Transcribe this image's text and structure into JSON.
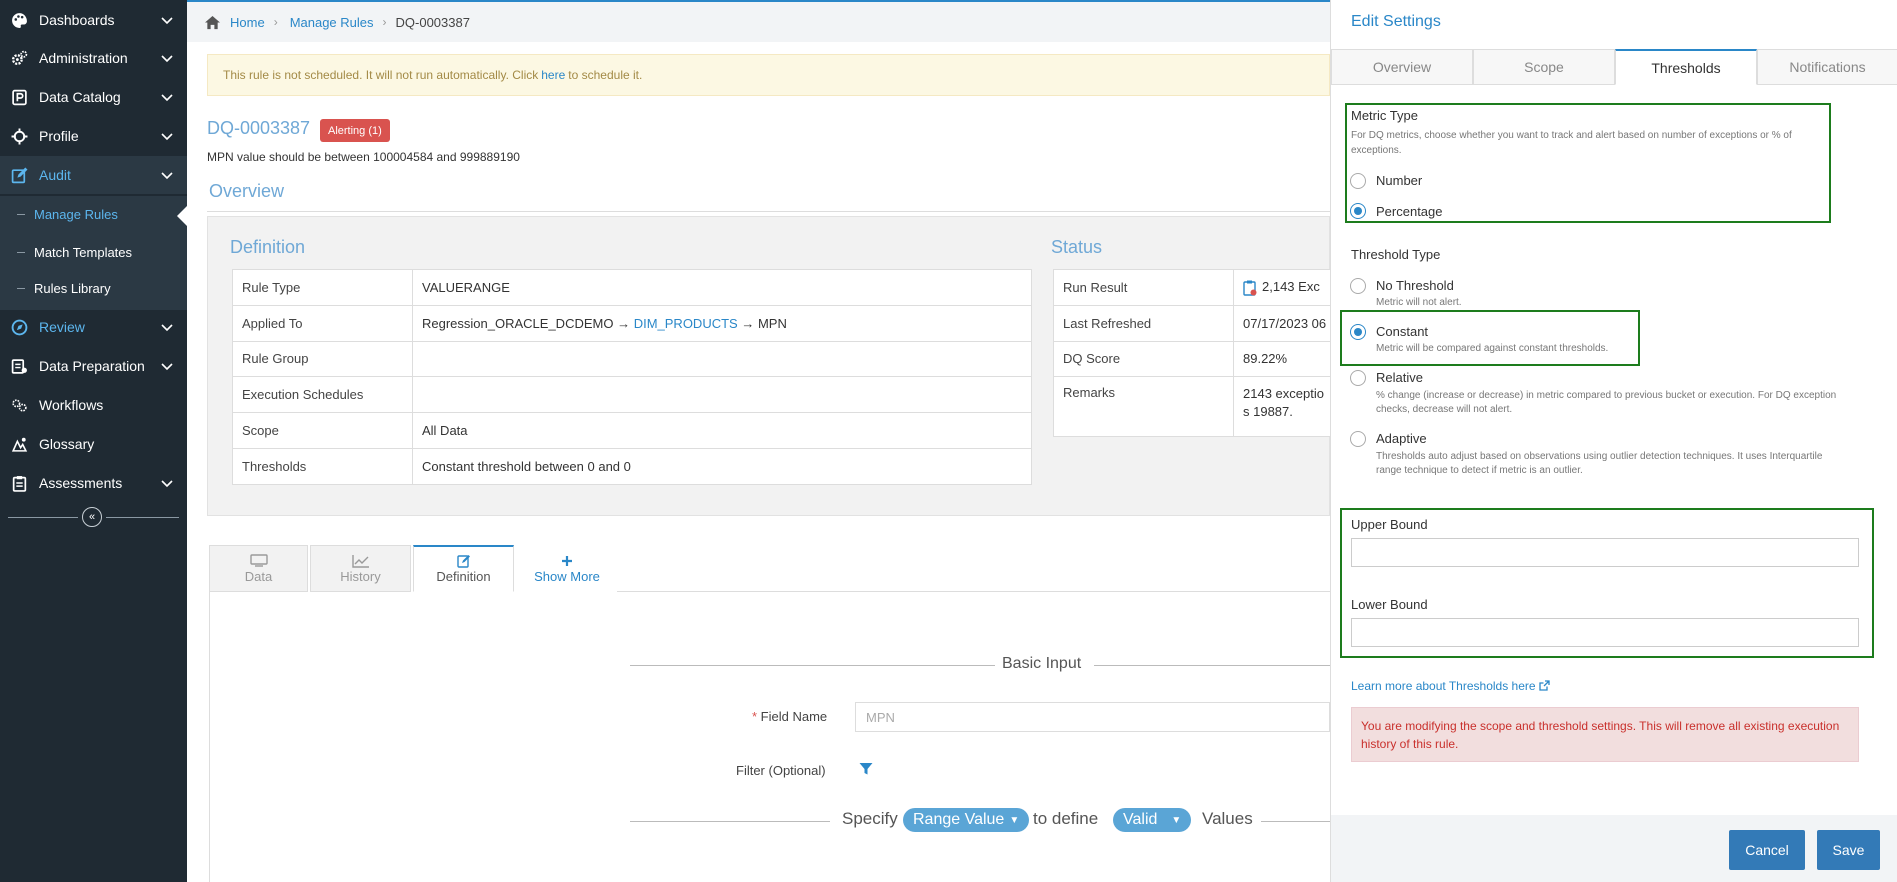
{
  "sidebar": {
    "items": [
      {
        "label": "Dashboards",
        "icon": "palette-icon"
      },
      {
        "label": "Administration",
        "icon": "cogs-icon"
      },
      {
        "label": "Data Catalog",
        "icon": "catalog-icon"
      },
      {
        "label": "Profile",
        "icon": "crosshair-icon"
      },
      {
        "label": "Audit",
        "icon": "edit-icon"
      },
      {
        "label": "Review",
        "icon": "compass-icon"
      },
      {
        "label": "Data Preparation",
        "icon": "data-prep-icon"
      },
      {
        "label": "Workflows",
        "icon": "workflow-icon"
      },
      {
        "label": "Glossary",
        "icon": "glossary-icon"
      },
      {
        "label": "Assessments",
        "icon": "clipboard-icon"
      }
    ],
    "sub_items": [
      "Manage Rules",
      "Match Templates",
      "Rules Library"
    ]
  },
  "breadcrumb": {
    "home": "Home",
    "parent": "Manage Rules",
    "current": "DQ-0003387"
  },
  "notice": {
    "before": "This rule is not scheduled. It will not run automatically. Click",
    "link": "here",
    "after": "to schedule it."
  },
  "rule": {
    "id": "DQ-0003387",
    "badge": "Alerting (1)",
    "description": "MPN value should be between 100004584 and 999889190"
  },
  "overview": {
    "title": "Overview",
    "definition_title": "Definition",
    "definition": [
      {
        "key": "Rule Type",
        "value": "VALUERANGE"
      },
      {
        "key": "Applied To",
        "value_pre": "Regression_ORACLE_DCDEMO",
        "value_arrow1": "→",
        "value_link": "DIM_PRODUCTS",
        "value_arrow2": "→",
        "value_post": "MPN"
      },
      {
        "key": "Rule Group",
        "value": ""
      },
      {
        "key": "Execution Schedules",
        "value": ""
      },
      {
        "key": "Scope",
        "value": "All Data"
      },
      {
        "key": "Thresholds",
        "value": "Constant threshold between 0 and 0"
      }
    ],
    "status_title": "Status",
    "status": [
      {
        "key": "Run Result",
        "value": "2,143 Exc"
      },
      {
        "key": "Last Refreshed",
        "value": "07/17/2023 06"
      },
      {
        "key": "DQ Score",
        "value": "89.22%"
      },
      {
        "key": "Remarks",
        "value_line1": "2143 exceptio",
        "value_line2": "s 19887."
      }
    ]
  },
  "bottom_tabs": [
    {
      "label": "Data",
      "icon": "data-tab-icon"
    },
    {
      "label": "History",
      "icon": "chart-line-icon"
    },
    {
      "label": "Definition",
      "icon": "edit-icon"
    },
    {
      "label": "Show More",
      "icon": "plus-icon"
    }
  ],
  "definition_form": {
    "section": "Basic Input",
    "field_name_label": "Field Name",
    "field_name_value": "MPN",
    "filter_label": "Filter (Optional)",
    "specify": "Specify",
    "range_value": "Range Value",
    "to_define": "to define",
    "valid": "Valid",
    "values": "Values"
  },
  "panel": {
    "title": "Edit Settings",
    "tabs": [
      "Overview",
      "Scope",
      "Thresholds",
      "Notifications"
    ],
    "metric_type": {
      "title": "Metric Type",
      "help": "For DQ metrics, choose whether you want to track and alert based on number of exceptions or % of exceptions.",
      "options": [
        "Number",
        "Percentage"
      ],
      "selected": "Percentage"
    },
    "threshold_type": {
      "title": "Threshold Type",
      "options": [
        {
          "label": "No Threshold",
          "help": "Metric will not alert."
        },
        {
          "label": "Constant",
          "help": "Metric will be compared against constant thresholds."
        },
        {
          "label": "Relative",
          "help_line1": "% change (increase or decrease) in metric compared to previous bucket or execution. For DQ exception",
          "help_line2": "checks, decrease will not alert."
        },
        {
          "label": "Adaptive",
          "help_line1": "Thresholds auto adjust based on observations using outlier detection techniques. It uses Interquartile",
          "help_line2": "range technique to detect if metric is an outlier."
        }
      ],
      "selected": "Constant"
    },
    "upper_bound_label": "Upper Bound",
    "upper_bound_value": "",
    "lower_bound_label": "Lower Bound",
    "lower_bound_value": "",
    "learn_more": "Learn more about Thresholds here",
    "warning": "You are modifying the scope and threshold settings. This will remove all existing execution history of this rule.",
    "cancel": "Cancel",
    "save": "Save"
  },
  "colors": {
    "accent": "#2a87c8",
    "sidebar_bg": "#1f2a33",
    "alert": "#d9534f",
    "highlight_box": "#1d7c1d"
  }
}
